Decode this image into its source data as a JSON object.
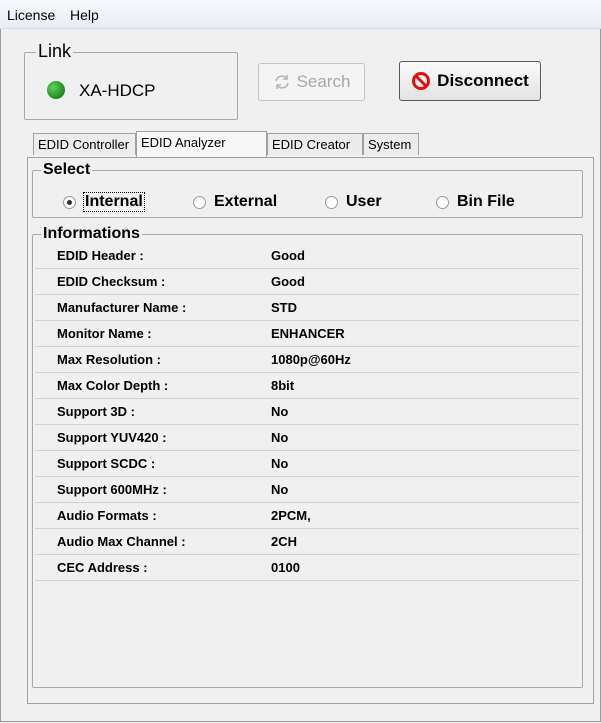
{
  "menu": {
    "items": [
      "License",
      "Help"
    ]
  },
  "link": {
    "title": "Link",
    "device_name": "XA-HDCP",
    "status_color": "#22a022"
  },
  "buttons": {
    "search_label": "Search",
    "disconnect_label": "Disconnect"
  },
  "tabs": [
    "EDID Controller",
    "EDID Analyzer",
    "EDID Creator",
    "System"
  ],
  "active_tab": "EDID Analyzer",
  "select": {
    "title": "Select",
    "options": [
      "Internal",
      "External",
      "User",
      "Bin File"
    ],
    "selected": "Internal"
  },
  "informations": {
    "title": "Informations",
    "rows": [
      {
        "label": "EDID Header :",
        "value": "Good"
      },
      {
        "label": "EDID Checksum :",
        "value": "Good"
      },
      {
        "label": "Manufacturer Name :",
        "value": "STD"
      },
      {
        "label": "Monitor Name :",
        "value": "ENHANCER"
      },
      {
        "label": "Max Resolution :",
        "value": "1080p@60Hz"
      },
      {
        "label": "Max Color Depth :",
        "value": "8bit"
      },
      {
        "label": "Support 3D :",
        "value": "No"
      },
      {
        "label": "Support YUV420 :",
        "value": "No"
      },
      {
        "label": "Support SCDC :",
        "value": "No"
      },
      {
        "label": "Support 600MHz :",
        "value": "No"
      },
      {
        "label": "Audio Formats :",
        "value": "2PCM,"
      },
      {
        "label": "Audio Max Channel :",
        "value": "2CH"
      },
      {
        "label": "CEC Address :",
        "value": "0100"
      }
    ]
  }
}
